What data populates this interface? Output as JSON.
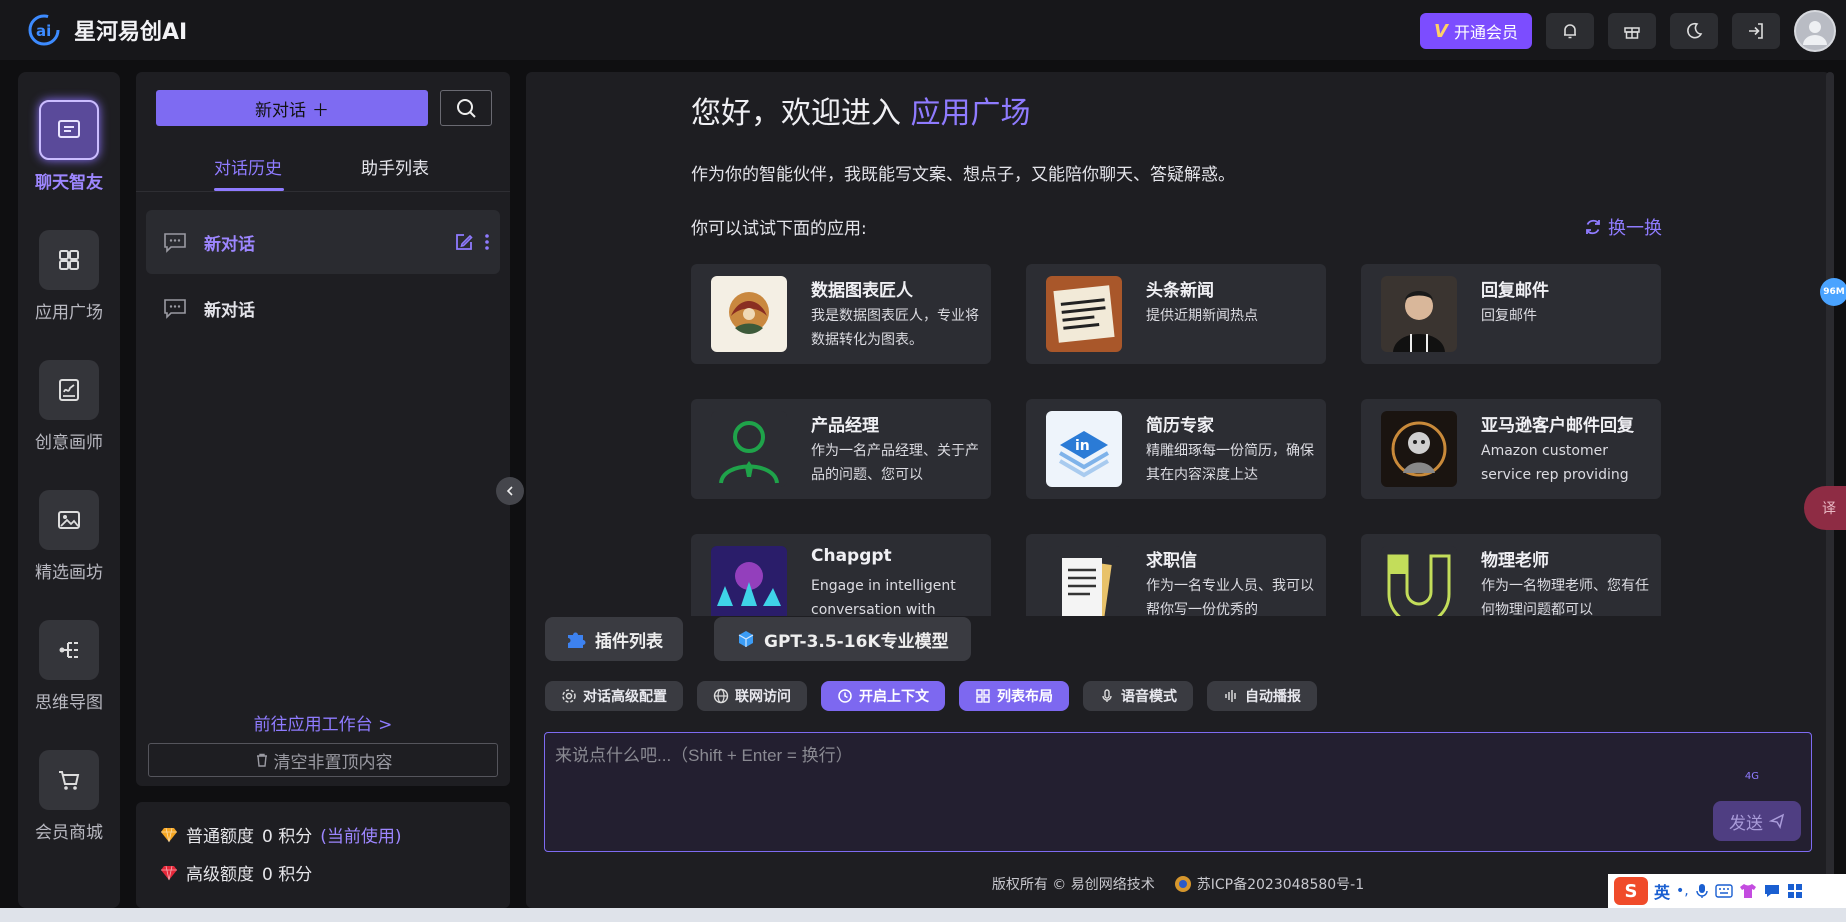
{
  "app": {
    "name": "星河易创AI"
  },
  "header": {
    "vip_label": "开通会员",
    "vip_mark": "V"
  },
  "nav": [
    {
      "label": "聊天智友",
      "icon": "chat-icon"
    },
    {
      "label": "应用广场",
      "icon": "grid-icon"
    },
    {
      "label": "创意画师",
      "icon": "sketch-icon"
    },
    {
      "label": "精选画坊",
      "icon": "image-icon"
    },
    {
      "label": "思维导图",
      "icon": "mindmap-icon"
    },
    {
      "label": "会员商城",
      "icon": "cart-icon"
    }
  ],
  "sidebar": {
    "new_chat_label": "新对话",
    "tabs": [
      "对话历史",
      "助手列表"
    ],
    "conversations": [
      "新对话",
      "新对话"
    ],
    "workbench_link": "前往应用工作台 >",
    "clear_label": "清空非置顶内容"
  },
  "quota": {
    "normal_label": "普通额度",
    "normal_value": "0 积分",
    "current_use": "(当前使用)",
    "advanced_label": "高级额度",
    "advanced_value": "0 积分"
  },
  "main": {
    "welcome_prefix": "您好，欢迎进入",
    "welcome_highlight": "应用广场",
    "intro": "作为你的智能伙伴，我既能写文案、想点子，又能陪你聊天、答疑解惑。",
    "try_label": "你可以试试下面的应用:",
    "refresh_label": "换一换",
    "apps": [
      {
        "title": "数据图表匠人",
        "desc": "我是数据图表匠人，专业将数据转化为图表。"
      },
      {
        "title": "头条新闻",
        "desc": "提供近期新闻热点"
      },
      {
        "title": "回复邮件",
        "desc": "回复邮件"
      },
      {
        "title": "产品经理",
        "desc": "作为一名产品经理、关于产品的问题、您可以"
      },
      {
        "title": "简历专家",
        "desc": "精雕细琢每一份简历，确保其在内容深度上达"
      },
      {
        "title": "亚马逊客户邮件回复",
        "desc": "Amazon customer service rep providing"
      },
      {
        "title": "Chapgpt",
        "desc": "Engage in intelligent conversation with"
      },
      {
        "title": "求职信",
        "desc": "作为一名专业人员、我可以帮你写一份优秀的"
      },
      {
        "title": "物理老师",
        "desc": "作为一名物理老师、您有任何物理问题都可以"
      }
    ],
    "plugin_label": "插件列表",
    "model_label": "GPT-3.5-16K专业模型",
    "chips": [
      {
        "label": "对话高级配置",
        "on": false
      },
      {
        "label": "联网访问",
        "on": false
      },
      {
        "label": "开启上下文",
        "on": true
      },
      {
        "label": "列表布局",
        "on": true
      },
      {
        "label": "语音模式",
        "on": false
      },
      {
        "label": "自动播报",
        "on": false
      }
    ],
    "input_placeholder": "来说点什么吧...（Shift + Enter = 换行）",
    "input_counter": "4G",
    "send_label": "发送",
    "footer_copyright": "版权所有 © 易创网络技术",
    "footer_icp": "苏ICP备2023048580号-1"
  },
  "overlays": {
    "memory_badge": "96M",
    "translate": "译",
    "ime_lang": "英"
  },
  "colors": {
    "accent": "#7e6bf2",
    "vip": "#7c4dff",
    "panel": "#1e1e22"
  }
}
